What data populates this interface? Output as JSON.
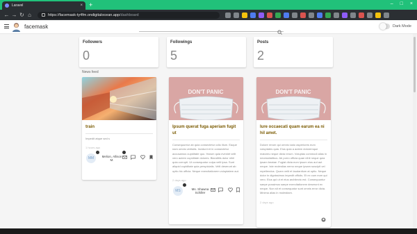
{
  "browser": {
    "tab_title": "Laravel",
    "url_host": "https://facemask-ty4fm.ondigitalocean.app",
    "url_path": "/dashboard"
  },
  "header": {
    "app_title": "facemask",
    "dark_mode_label": "Dark Mode",
    "dark_mode_on": false
  },
  "stats": [
    {
      "label": "Followers",
      "value": "0"
    },
    {
      "label": "Followings",
      "value": "5"
    },
    {
      "label": "Posts",
      "value": "2"
    }
  ],
  "news_feed_label": "News feed",
  "posts": [
    {
      "title": "train",
      "body": "Impedit atque sed s",
      "time": "1 hours ago",
      "author_initials": "MM",
      "author_name": "Melion, Allison M.",
      "image": "subway-train-photo"
    },
    {
      "title": "Ipsum querat fuga aperiam fugit ut",
      "body": "Consequuntur ab quia consectetur odio illum. Eaque nam omnis veritatis. Incidunt et in consectetur accusamus cupiditate quo. Harum quia eveniet velit vero autem cupiditate dolores. Blanditiis dolor nihil quia corrupti. Ut consequatur culpa velit ipsa. Sunt aliquid cupiditate quia perspiciatis. Velit deserunt ab optio hic officia. Neque exercitationem voluptatem aut.",
      "time": "2 days ago",
      "author_initials": "MS",
      "author_name": "Ms. Shawna Schiller",
      "image": "dont-panic-mask-photo"
    },
    {
      "title": "Iure occaecati quam earum ea ni hil amet.",
      "body": "Dolore rerum qui omnis iusto asperiores eum voluptates quia. Eius quia a autem doloremque maiores neque dicta rerum. Voluptas commodi alias in necessitatibus. Ab porro officia quae nihil neque quia ipsam beatae. Fugiat dicta eum ipsum eius aut aut neque. Iste molestias nemo neque ipsam suscipit vel repellendus. Quam velit et laudantium at optio. Neque dolor in dignissimos impedit officiis. Et ex cum eum qui vero. Eius qui ut et eius architecto est. Consequuntur saepe possimus saepe exercitationem deserunt ex neque. Non sit et consequatur sunt omnis error dicta. Minima alias in molestiam.",
      "time": "2 days ago",
      "author_initials": "",
      "author_name": "",
      "image": "dont-panic-mask-photo"
    }
  ],
  "mask_sign_text": "DON'T PANIC",
  "colors": {
    "browser_accent": "#21c17a",
    "post_title": "#7a5a00",
    "stat_value": "#888888"
  },
  "icons": [
    "menu-icon",
    "search-icon",
    "heart-icon",
    "comment-icon",
    "bookmark-icon",
    "message-icon"
  ]
}
